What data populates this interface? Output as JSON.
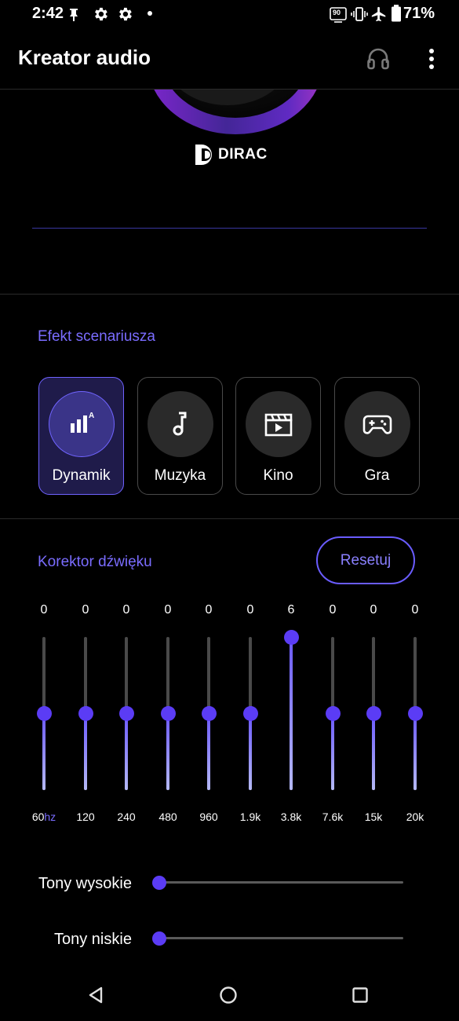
{
  "status_bar": {
    "time": "2:42",
    "battery": "71%",
    "refresh_rate_badge": "90",
    "icons": [
      "notification-pin-icon",
      "gear-icon",
      "gear-icon",
      "dot-icon",
      "refresh-rate-icon",
      "vibrate-icon",
      "airplane-icon",
      "battery-icon"
    ]
  },
  "app_bar": {
    "title": "Kreator audio",
    "actions": [
      "headphones-icon",
      "more-vert-icon"
    ]
  },
  "dirac": {
    "brand": "DIRAC"
  },
  "scenario": {
    "label": "Efekt scenariusza",
    "items": [
      {
        "label": "Dynamik",
        "icon": "dynamic-bars-icon",
        "active": true
      },
      {
        "label": "Muzyka",
        "icon": "music-note-icon",
        "active": false
      },
      {
        "label": "Kino",
        "icon": "clapperboard-icon",
        "active": false
      },
      {
        "label": "Gra",
        "icon": "gamepad-icon",
        "active": false
      }
    ]
  },
  "equalizer": {
    "label": "Korektor dźwięku",
    "reset_label": "Resetuj",
    "range": [
      -6,
      6
    ],
    "bands": [
      {
        "freq": "60",
        "unit": "hz",
        "value": 0
      },
      {
        "freq": "120",
        "value": 0
      },
      {
        "freq": "240",
        "value": 0
      },
      {
        "freq": "480",
        "value": 0
      },
      {
        "freq": "960",
        "value": 0
      },
      {
        "freq": "1.9k",
        "value": 0
      },
      {
        "freq": "3.8k",
        "value": 6
      },
      {
        "freq": "7.6k",
        "value": 0
      },
      {
        "freq": "15k",
        "value": 0
      },
      {
        "freq": "20k",
        "value": 0
      }
    ]
  },
  "tones": {
    "treble_label": "Tony wysokie",
    "treble_value": 0,
    "bass_label": "Tony niskie",
    "bass_value": 0
  },
  "nav_bar": {
    "icons": [
      "back-icon",
      "home-icon",
      "recents-icon"
    ]
  },
  "colors": {
    "accent": "#5b3cf5",
    "accent_text": "#7a6cff",
    "background": "#000000",
    "active_card": "#1f1b4a"
  }
}
